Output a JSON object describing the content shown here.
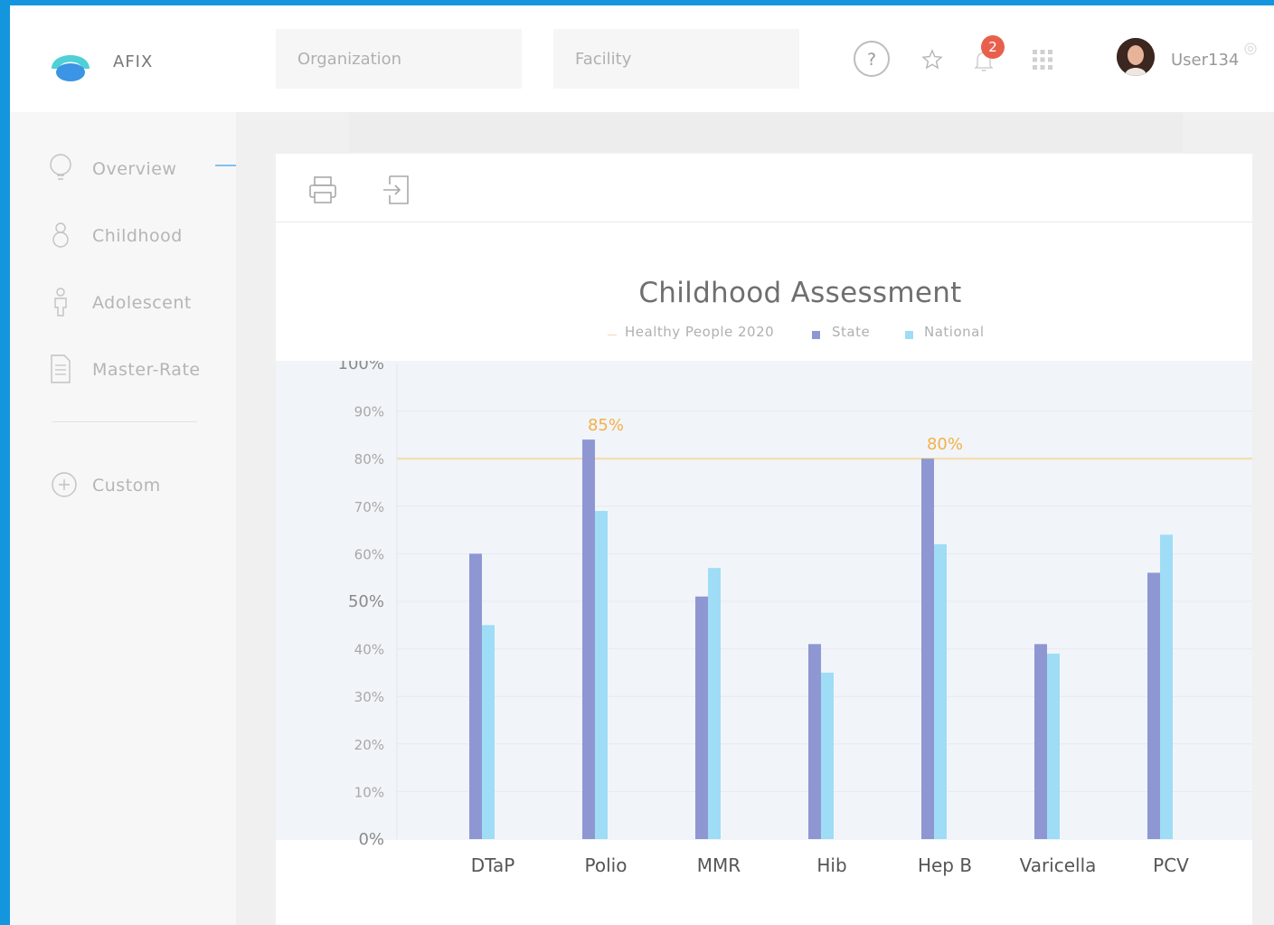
{
  "header": {
    "brand": "AFIX",
    "organization_placeholder": "Organization",
    "facility_placeholder": "Facility",
    "notifications_count": "2",
    "username": "User134"
  },
  "sidebar": {
    "items": [
      {
        "label": "Overview",
        "icon": "lightbulb-icon"
      },
      {
        "label": "Childhood",
        "icon": "baby-icon"
      },
      {
        "label": "Adolescent",
        "icon": "person-icon"
      },
      {
        "label": "Master-Rate",
        "icon": "document-icon"
      }
    ],
    "custom_label": "Custom"
  },
  "colors": {
    "accent": "#1396dd",
    "state": "#8e97d2",
    "national": "#9fdcf5",
    "target_line": "#f4d9a8",
    "annotation": "#f3b04a",
    "plot_bg": "#f1f5f9"
  },
  "chart_data": {
    "type": "bar",
    "title": "Childhood Assessment",
    "legend": [
      "Healthy People 2020",
      "State",
      "National"
    ],
    "legend_position": "top",
    "categories": [
      "DTaP",
      "Polio",
      "MMR",
      "Hib",
      "Hep B",
      "Varicella",
      "PCV"
    ],
    "series": [
      {
        "name": "State",
        "values": [
          60,
          84,
          51,
          41,
          80,
          41,
          56
        ]
      },
      {
        "name": "National",
        "values": [
          45,
          69,
          57,
          35,
          62,
          39,
          64
        ]
      }
    ],
    "reference_line": {
      "name": "Healthy People 2020",
      "value": 80
    },
    "annotations": [
      {
        "category": "Polio",
        "text": "85%"
      },
      {
        "category": "Hep B",
        "text": "80%"
      }
    ],
    "y_ticks": [
      "0%",
      "10%",
      "20%",
      "30%",
      "40%",
      "50%",
      "60%",
      "70%",
      "80%",
      "90%",
      "100%"
    ],
    "ylim": [
      0,
      100
    ],
    "grid": true
  }
}
